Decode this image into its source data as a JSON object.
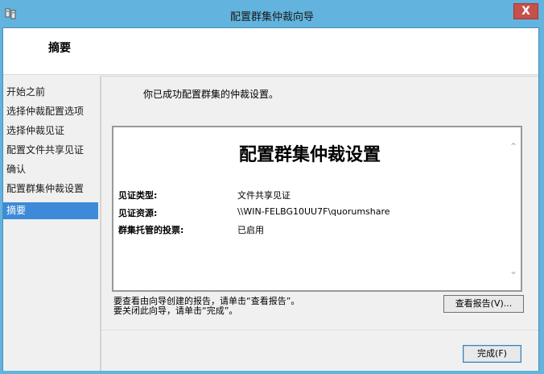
{
  "window": {
    "title": "配置群集仲裁向导",
    "close_label": "X"
  },
  "header": {
    "title": "摘要"
  },
  "nav": {
    "items": [
      {
        "label": "开始之前"
      },
      {
        "label": "选择仲裁配置选项"
      },
      {
        "label": "选择仲裁见证"
      },
      {
        "label": "配置文件共享见证"
      },
      {
        "label": "确认"
      },
      {
        "label": "配置群集仲裁设置"
      },
      {
        "label": "摘要"
      }
    ],
    "active_index": 6
  },
  "main": {
    "success_message": "你已成功配置群集的仲裁设置。",
    "report": {
      "title": "配置群集仲裁设置",
      "rows": [
        {
          "label": "见证类型:",
          "value": "文件共享见证"
        },
        {
          "label": "见证资源:",
          "value": "\\\\WIN-FELBG10UU7F\\quorumshare"
        },
        {
          "label": "群集托管的投票:",
          "value": "已启用"
        }
      ]
    },
    "hint_line1": "要查看由向导创建的报告，请单击“查看报告”。",
    "hint_line2": "要关闭此向导，请单击“完成”。",
    "view_report_label": "查看报告(V)...",
    "finish_label": "完成(F)"
  },
  "colors": {
    "title_bar": "#62b3dd",
    "close_button": "#c7504b",
    "nav_active": "#3d8ad9"
  }
}
